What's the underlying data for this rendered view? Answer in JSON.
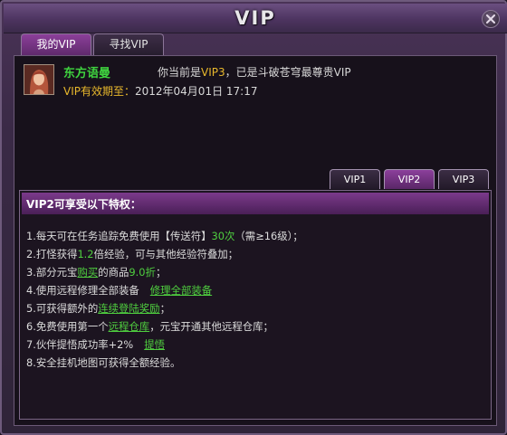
{
  "window": {
    "title": "VIP"
  },
  "tabs": [
    {
      "label": "我的VIP"
    },
    {
      "label": "寻找VIP"
    }
  ],
  "profile": {
    "name": "东方语曼",
    "status_prefix": "你当前是",
    "vip_level": "VIP3",
    "status_suffix": "，已是斗破苍穹最尊贵VIP",
    "expiry_label": "VIP有效期至：",
    "expiry_date": "2012年04月01日 17:17"
  },
  "vip_tabs": [
    {
      "label": "VIP1"
    },
    {
      "label": "VIP2"
    },
    {
      "label": "VIP3"
    }
  ],
  "perks_panel": {
    "title": "VIP2可享受以下特权：",
    "items": [
      {
        "a": "1.每天可在任务追踪免费使用【传送符】",
        "b": "30次",
        "c": "（需≥16级）；"
      },
      {
        "a": "2.打怪获得",
        "b": "1.2",
        "c": "倍经验，可与其他经验符叠加；"
      },
      {
        "a": "3.部分元宝",
        "b": "购买",
        "c": "的商品",
        "d": "9.0折",
        "e": "；"
      },
      {
        "a": "4.使用远程修理全部装备",
        "b": "修理全部装备"
      },
      {
        "a": "5.可获得额外的",
        "b": "连续登陆奖励",
        "c": "；"
      },
      {
        "a": "6.免费使用第一个",
        "b": "远程仓库",
        "c": "，元宝开通其他远程仓库；"
      },
      {
        "a": "7.伙伴提悟成功率+2%",
        "b": "提悟"
      },
      {
        "a": "8.安全挂机地图可获得全额经验。"
      }
    ]
  },
  "colors": {
    "highlight_green": "#4fcf3f",
    "highlight_yellow": "#e8b82c",
    "accent_purple": "#7b3a8b"
  }
}
